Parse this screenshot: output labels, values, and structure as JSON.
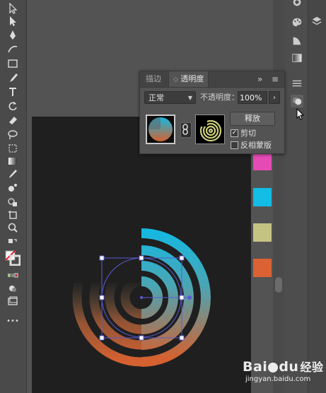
{
  "toolbar": {
    "tools": [
      "selection-tool",
      "direct-selection-tool",
      "pen-tool",
      "curvature-tool",
      "rectangle-tool",
      "paintbrush-tool",
      "type-tool",
      "rotate-tool",
      "eraser-tool",
      "lasso-tool",
      "free-transform-tool",
      "gradient-tool",
      "eyedropper-tool",
      "symbol-sprayer-tool",
      "shape-builder-tool",
      "artboard-tool",
      "hand-tool",
      "zoom-tool",
      "fill-stroke-swap",
      "fill-stroke-swatch",
      "color-mode-buttons",
      "draw-mode-button",
      "screen-mode-button",
      "more-tools"
    ],
    "more": "•••"
  },
  "panel": {
    "tab_stroke": "描边",
    "tab_transparency": "透明度",
    "tab_prefix": "◇",
    "menu_glyph": "≡",
    "expand_glyph": "»",
    "blend_mode": "正常",
    "opacity_label": "不透明度：",
    "opacity_value": "100%",
    "release_button": "释放",
    "clip_label": "剪切",
    "invert_mask_label": "反相蒙版",
    "clip_checked": "✓"
  },
  "swatches": [
    {
      "name": "magenta",
      "color": "#e64bb5"
    },
    {
      "name": "cyan",
      "color": "#13bde6"
    },
    {
      "name": "khaki",
      "color": "#c5c382"
    },
    {
      "name": "orange",
      "color": "#da6234"
    }
  ],
  "colors": {
    "artboard": "#1f1f1f",
    "gradient_top": "#12b9e4",
    "gradient_bottom": "#d4612f",
    "selection": "#5b5bd6"
  },
  "watermark": {
    "brand": "Bai",
    "paw": "du",
    "suffix": "经验",
    "url": "jingyan.baidu.com"
  }
}
